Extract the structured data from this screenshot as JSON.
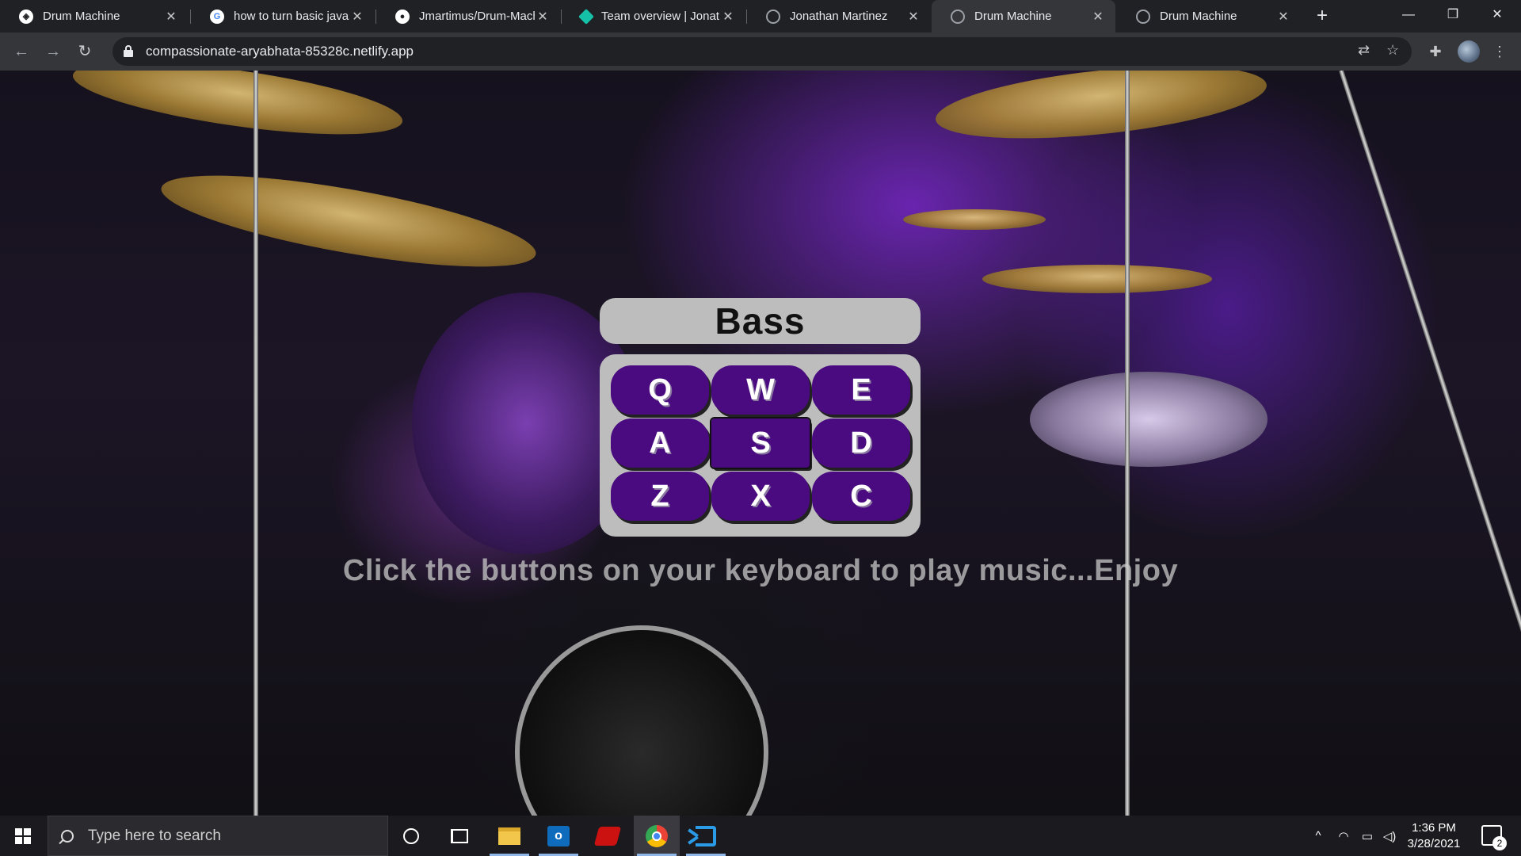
{
  "browser": {
    "tabs": [
      {
        "title": "Drum Machine",
        "icon": "netlify-dark-icon",
        "active": false
      },
      {
        "title": "how to turn basic javas",
        "icon": "google-icon",
        "active": false
      },
      {
        "title": "Jmartimus/Drum-Mach",
        "icon": "github-icon",
        "active": false
      },
      {
        "title": "Team overview | Jonath",
        "icon": "netlify-icon",
        "active": false
      },
      {
        "title": "Jonathan Martinez",
        "icon": "globe-icon",
        "active": false
      },
      {
        "title": "Drum Machine",
        "icon": "globe-icon",
        "active": true
      },
      {
        "title": "Drum Machine",
        "icon": "globe-icon",
        "active": false
      }
    ],
    "new_tab_label": "+",
    "url": "compassionate-aryabhata-85328c.netlify.app"
  },
  "app": {
    "display": "Bass",
    "pads": [
      {
        "key": "Q",
        "focused": false
      },
      {
        "key": "W",
        "focused": false
      },
      {
        "key": "E",
        "focused": false
      },
      {
        "key": "A",
        "focused": false
      },
      {
        "key": "S",
        "focused": true
      },
      {
        "key": "D",
        "focused": false
      },
      {
        "key": "Z",
        "focused": false
      },
      {
        "key": "X",
        "focused": false
      },
      {
        "key": "C",
        "focused": false
      }
    ],
    "instructions": "Click the buttons on your keyboard to play music...Enjoy",
    "colors": {
      "pad": "#4a0a80",
      "panel": "#bdbdbd"
    }
  },
  "taskbar": {
    "search_placeholder": "Type here to search",
    "apps": [
      "cortana-icon",
      "task-view-icon",
      "file-explorer-icon",
      "outlook-icon",
      "red-app-icon",
      "chrome-icon",
      "vscode-icon"
    ],
    "time": "1:36 PM",
    "date": "3/28/2021",
    "notification_count": "2"
  }
}
